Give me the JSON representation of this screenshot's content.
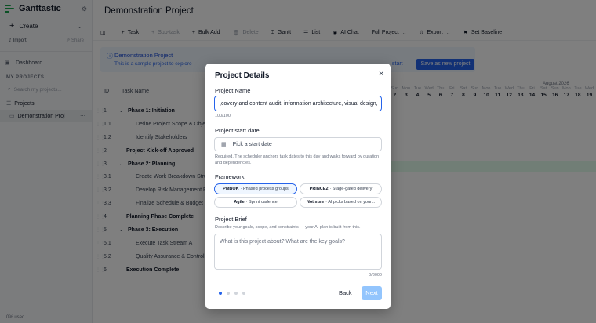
{
  "sidebar": {
    "brand": "Ganttastic",
    "create_label": "Create",
    "import_label": "Import",
    "share_label": "Share",
    "dashboard_label": "Dashboard",
    "my_projects_heading": "MY PROJECTS",
    "search_placeholder": "Search my projects...",
    "projects_label": "Projects",
    "project_item": "Demonstration Proj",
    "footer": "0% used"
  },
  "main": {
    "title": "Demonstration Project",
    "toolbar": [
      {
        "label": "Task",
        "icon": "plus-icon",
        "disabled": false
      },
      {
        "label": "Sub-task",
        "icon": "plus-icon",
        "disabled": true
      },
      {
        "label": "Bulk Add",
        "icon": "plus-icon",
        "disabled": false
      },
      {
        "label": "Delete",
        "icon": "trash-icon",
        "disabled": true
      },
      {
        "label": "Gantt",
        "icon": "gantt-icon",
        "disabled": false
      },
      {
        "label": "List",
        "icon": "list-icon",
        "disabled": false
      },
      {
        "label": "AI Chat",
        "icon": "chat-icon",
        "disabled": false
      },
      {
        "label": "Full Project",
        "icon": "",
        "disabled": false,
        "dropdown": true
      },
      {
        "label": "Export",
        "icon": "download-icon",
        "disabled": false,
        "dropdown": true
      },
      {
        "label": "Set Baseline",
        "icon": "baseline-icon",
        "disabled": false
      }
    ],
    "banner_title": "Demonstration Project",
    "banner_text": "This is a sample project to explore",
    "banner_start": "start",
    "save_button": "Save as new project",
    "columns": {
      "id": "ID",
      "name": "Task Name"
    },
    "timeline_month": "August 2026",
    "days": [
      {
        "d": "Sun",
        "n": "2"
      },
      {
        "d": "Mon",
        "n": "3"
      },
      {
        "d": "Tue",
        "n": "4"
      },
      {
        "d": "Wed",
        "n": "5"
      },
      {
        "d": "Thu",
        "n": "6"
      },
      {
        "d": "Fri",
        "n": "7"
      },
      {
        "d": "Sat",
        "n": "8"
      },
      {
        "d": "Sun",
        "n": "9"
      },
      {
        "d": "Mon",
        "n": "10"
      },
      {
        "d": "Tue",
        "n": "11"
      },
      {
        "d": "Wed",
        "n": "12"
      },
      {
        "d": "Thu",
        "n": "13"
      },
      {
        "d": "Fri",
        "n": "14"
      },
      {
        "d": "Sat",
        "n": "15"
      },
      {
        "d": "Sun",
        "n": "16"
      },
      {
        "d": "Mon",
        "n": "17"
      },
      {
        "d": "Tue",
        "n": "18"
      },
      {
        "d": "Wed",
        "n": "19"
      }
    ],
    "rows": [
      {
        "id": "1",
        "name": "Phase 1: Initiation",
        "bold": true,
        "expand": true
      },
      {
        "id": "1.1",
        "name": "Define Project Scope & Objectives",
        "bold": false
      },
      {
        "id": "1.2",
        "name": "Identify Stakeholders",
        "bold": false
      },
      {
        "id": "2",
        "name": "Project Kick-off Approved",
        "bold": true
      },
      {
        "id": "3",
        "name": "Phase 2: Planning",
        "bold": true,
        "expand": true
      },
      {
        "id": "3.1",
        "name": "Create Work Breakdown Structure",
        "bold": false
      },
      {
        "id": "3.2",
        "name": "Develop Risk Management Plan",
        "bold": false
      },
      {
        "id": "3.3",
        "name": "Finalize Schedule & Budget",
        "bold": false
      },
      {
        "id": "4",
        "name": "Planning Phase Complete",
        "bold": true
      },
      {
        "id": "5",
        "name": "Phase 3: Execution",
        "bold": true,
        "expand": true
      },
      {
        "id": "5.1",
        "name": "Execute Task Stream A",
        "bold": false
      },
      {
        "id": "5.2",
        "name": "Quality Assurance & Control",
        "bold": false
      },
      {
        "id": "6",
        "name": "Execution Complete",
        "bold": true
      }
    ]
  },
  "modal": {
    "title": "Project Details",
    "name_label": "Project Name",
    "name_value": ",covery and content audit, information architecture, visual design,",
    "name_count": "100/100",
    "start_label": "Project start date",
    "start_placeholder": "Pick a start date",
    "start_help": "Required. The scheduler anchors task dates to this day and walks forward by duration and dependencies.",
    "framework_label": "Framework",
    "frameworks": [
      {
        "name": "PMBOK",
        "desc": "· Phased process groups",
        "selected": true
      },
      {
        "name": "PRINCE2",
        "desc": "· Stage-gated delivery",
        "selected": false
      },
      {
        "name": "Agile",
        "desc": "· Sprint cadence",
        "selected": false
      },
      {
        "name": "Not sure",
        "desc": "· AI picks based on your...",
        "selected": false
      }
    ],
    "brief_label": "Project Brief",
    "brief_help": "Describe your goals, scope, and constraints — your AI plan is built from this.",
    "brief_placeholder": "What is this project about? What are the key goals?",
    "brief_count": "0/3000",
    "back_label": "Back",
    "next_label": "Next",
    "steps_total": 4,
    "step_current": 1
  }
}
